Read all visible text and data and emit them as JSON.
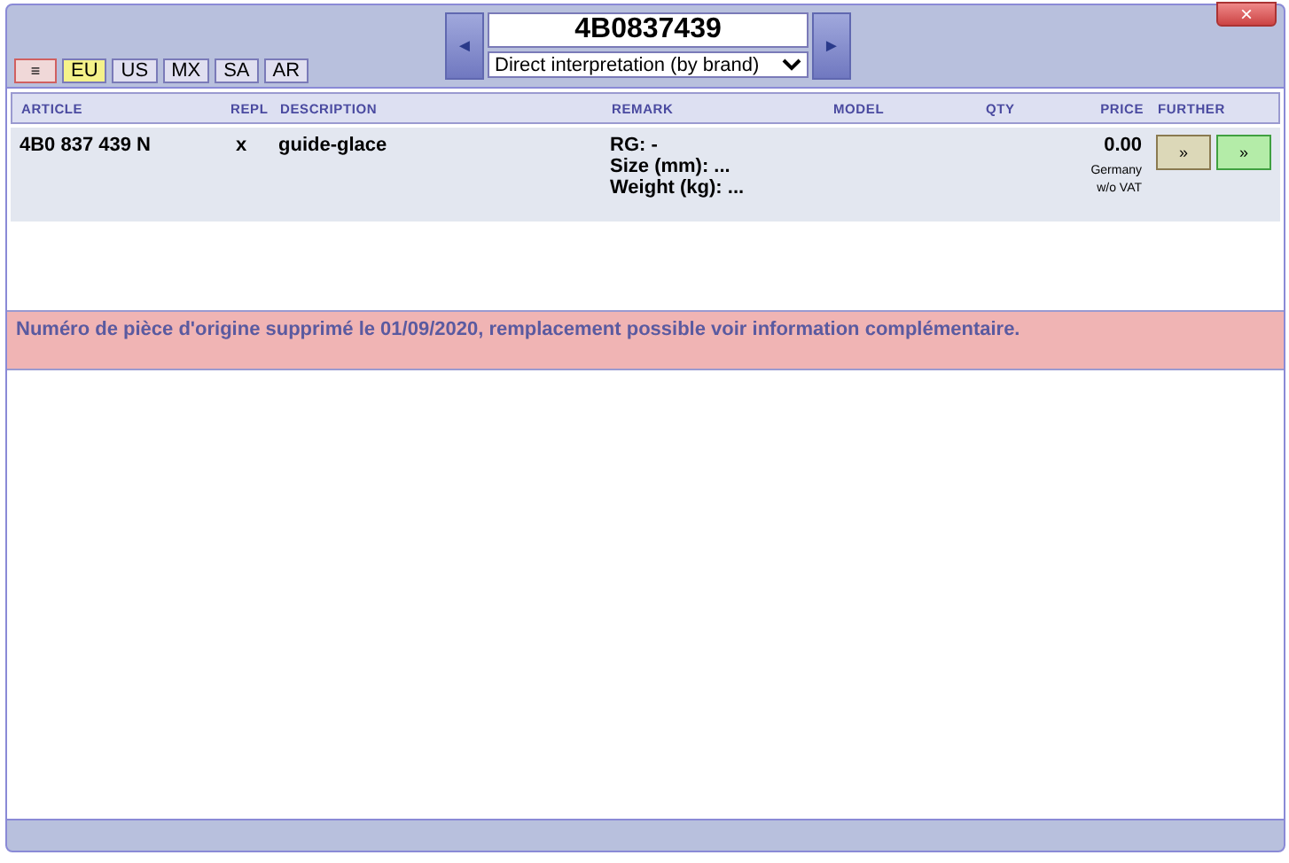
{
  "toolbar": {
    "menu_button": "≡",
    "regions": [
      {
        "label": "EU",
        "selected": true
      },
      {
        "label": "US",
        "selected": false
      },
      {
        "label": "MX",
        "selected": false
      },
      {
        "label": "SA",
        "selected": false
      },
      {
        "label": "AR",
        "selected": false
      }
    ],
    "search_value": "4B0837439",
    "mode": "Direct interpretation (by brand)",
    "prev": "◄",
    "next": "►",
    "close": "×"
  },
  "table": {
    "columns": [
      "ARTICLE",
      "REPL",
      "DESCRIPTION",
      "REMARK",
      "MODEL",
      "QTY",
      "PRICE",
      "FURTHER"
    ],
    "rows": [
      {
        "article": "4B0 837 439 N",
        "repl": "x",
        "description": "guide-glace",
        "remarks": [
          "RG: -",
          "Size (mm): ...",
          "Weight (kg): ..."
        ],
        "model": "",
        "qty": "",
        "price": "0.00",
        "price_note": [
          "Germany",
          "w/o VAT"
        ],
        "actions": [
          {
            "label": "»",
            "kind": "info"
          },
          {
            "label": "»",
            "kind": "cart"
          }
        ]
      }
    ]
  },
  "notice": "Numéro de pièce d'origine supprimé le 01/09/2020, remplacement possible voir information complémentaire."
}
